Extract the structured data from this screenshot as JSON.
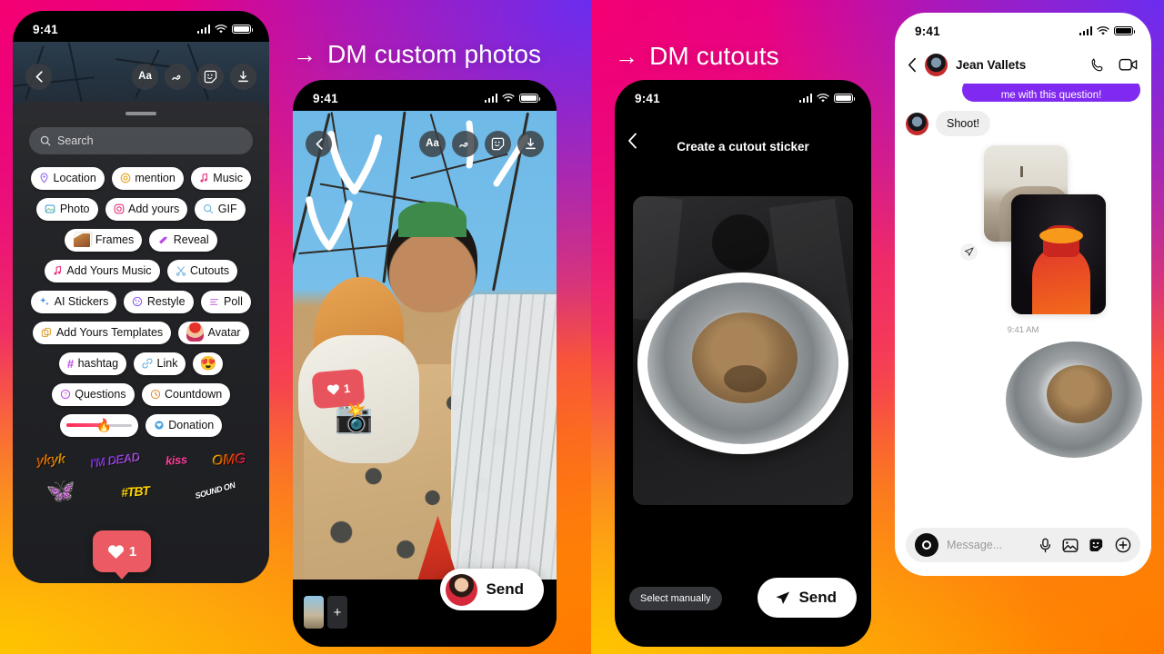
{
  "background": {
    "brand_pink": "#f40072",
    "brand_purple": "#6a2df0",
    "brand_orange": "#ff7a00",
    "brand_yellow": "#ffc400"
  },
  "callouts": [
    {
      "arrow": "→",
      "text": "DM custom photos"
    },
    {
      "arrow": "→",
      "text": "DM cutouts"
    }
  ],
  "phone1": {
    "status": {
      "time": "9:41"
    },
    "toolbar": {
      "back_icon": "chevron-left-icon",
      "text_tool": "Aa",
      "draw_tool": "draw-icon",
      "sticker_tool": "sticker-icon",
      "save_tool": "download-icon"
    },
    "search": {
      "placeholder": "Search",
      "icon": "search-icon"
    },
    "sticker_rows": [
      [
        {
          "icon": "📍",
          "label": "Location"
        },
        {
          "icon": "@",
          "label": "mention"
        },
        {
          "icon": "🎵",
          "label": "Music"
        }
      ],
      [
        {
          "icon": "🖼",
          "label": "Photo"
        },
        {
          "icon": "◎",
          "label": "Add yours"
        },
        {
          "icon": "🔍",
          "label": "GIF"
        }
      ],
      [
        {
          "icon": "🖼",
          "label": "Frames"
        },
        {
          "icon": "✨",
          "label": "Reveal"
        }
      ],
      [
        {
          "icon": "🎵",
          "label": "Add Yours Music"
        },
        {
          "icon": "✂",
          "label": "Cutouts"
        }
      ],
      [
        {
          "icon": "✨",
          "label": "AI Stickers"
        },
        {
          "icon": "🎨",
          "label": "Restyle"
        },
        {
          "icon": "≡",
          "label": "Poll"
        }
      ],
      [
        {
          "icon": "⧉",
          "label": "Add Yours Templates"
        },
        {
          "icon": "🧑",
          "label": "Avatar"
        }
      ],
      [
        {
          "icon": "#",
          "label": "hashtag"
        },
        {
          "icon": "🔗",
          "label": "Link"
        },
        {
          "icon": "😍",
          "label": ""
        }
      ],
      [
        {
          "icon": "?",
          "label": "Questions"
        },
        {
          "icon": "⏱",
          "label": "Countdown"
        }
      ],
      [
        {
          "icon": "🔥",
          "label": ""
        },
        {
          "icon": "💝",
          "label": "Donation"
        }
      ]
    ],
    "art_stickers": [
      "ykyk",
      "I'M DEAD",
      "kiss",
      "OMG"
    ],
    "art_stickers_row2": [
      "butterfly",
      "#TBT",
      "SOUND ON"
    ],
    "like_badge": {
      "icon": "heart-icon",
      "count": "1"
    }
  },
  "phone2": {
    "status": {
      "time": "9:41"
    },
    "toolbar": {
      "back_icon": "chevron-left-icon",
      "text_tool": "Aa",
      "draw_tool": "draw-icon",
      "sticker_tool": "sticker-icon",
      "save_tool": "download-icon"
    },
    "like_sticker": {
      "icon": "heart-icon",
      "count": "1"
    },
    "camera_sticker": "📸",
    "send": {
      "label": "Send",
      "avatar": "recipient-avatar"
    },
    "thumbnails": {
      "add_label": "+"
    }
  },
  "phone3": {
    "status": {
      "time": "9:41"
    },
    "title": "Create a cutout sticker",
    "back_icon": "chevron-left-icon",
    "select_manually": "Select manually",
    "send": {
      "label": "Send",
      "icon": "paper-plane-icon"
    }
  },
  "phone4": {
    "status": {
      "time": "9:41"
    },
    "header": {
      "back_icon": "chevron-left-icon",
      "name": "Jean Vallets",
      "call_icon": "phone-icon",
      "video_icon": "video-camera-icon"
    },
    "messages": [
      {
        "type": "outgoing-purple",
        "text": "me with this question!"
      },
      {
        "type": "incoming",
        "text": "Shoot!"
      },
      {
        "type": "photo-stack",
        "text": ""
      }
    ],
    "timestamp": "9:41 AM",
    "composer": {
      "placeholder": "Message...",
      "camera_icon": "camera-icon",
      "mic_icon": "microphone-icon",
      "gallery_icon": "image-icon",
      "sticker_icon": "sticker-icon",
      "plus_icon": "plus-circle-icon"
    }
  }
}
